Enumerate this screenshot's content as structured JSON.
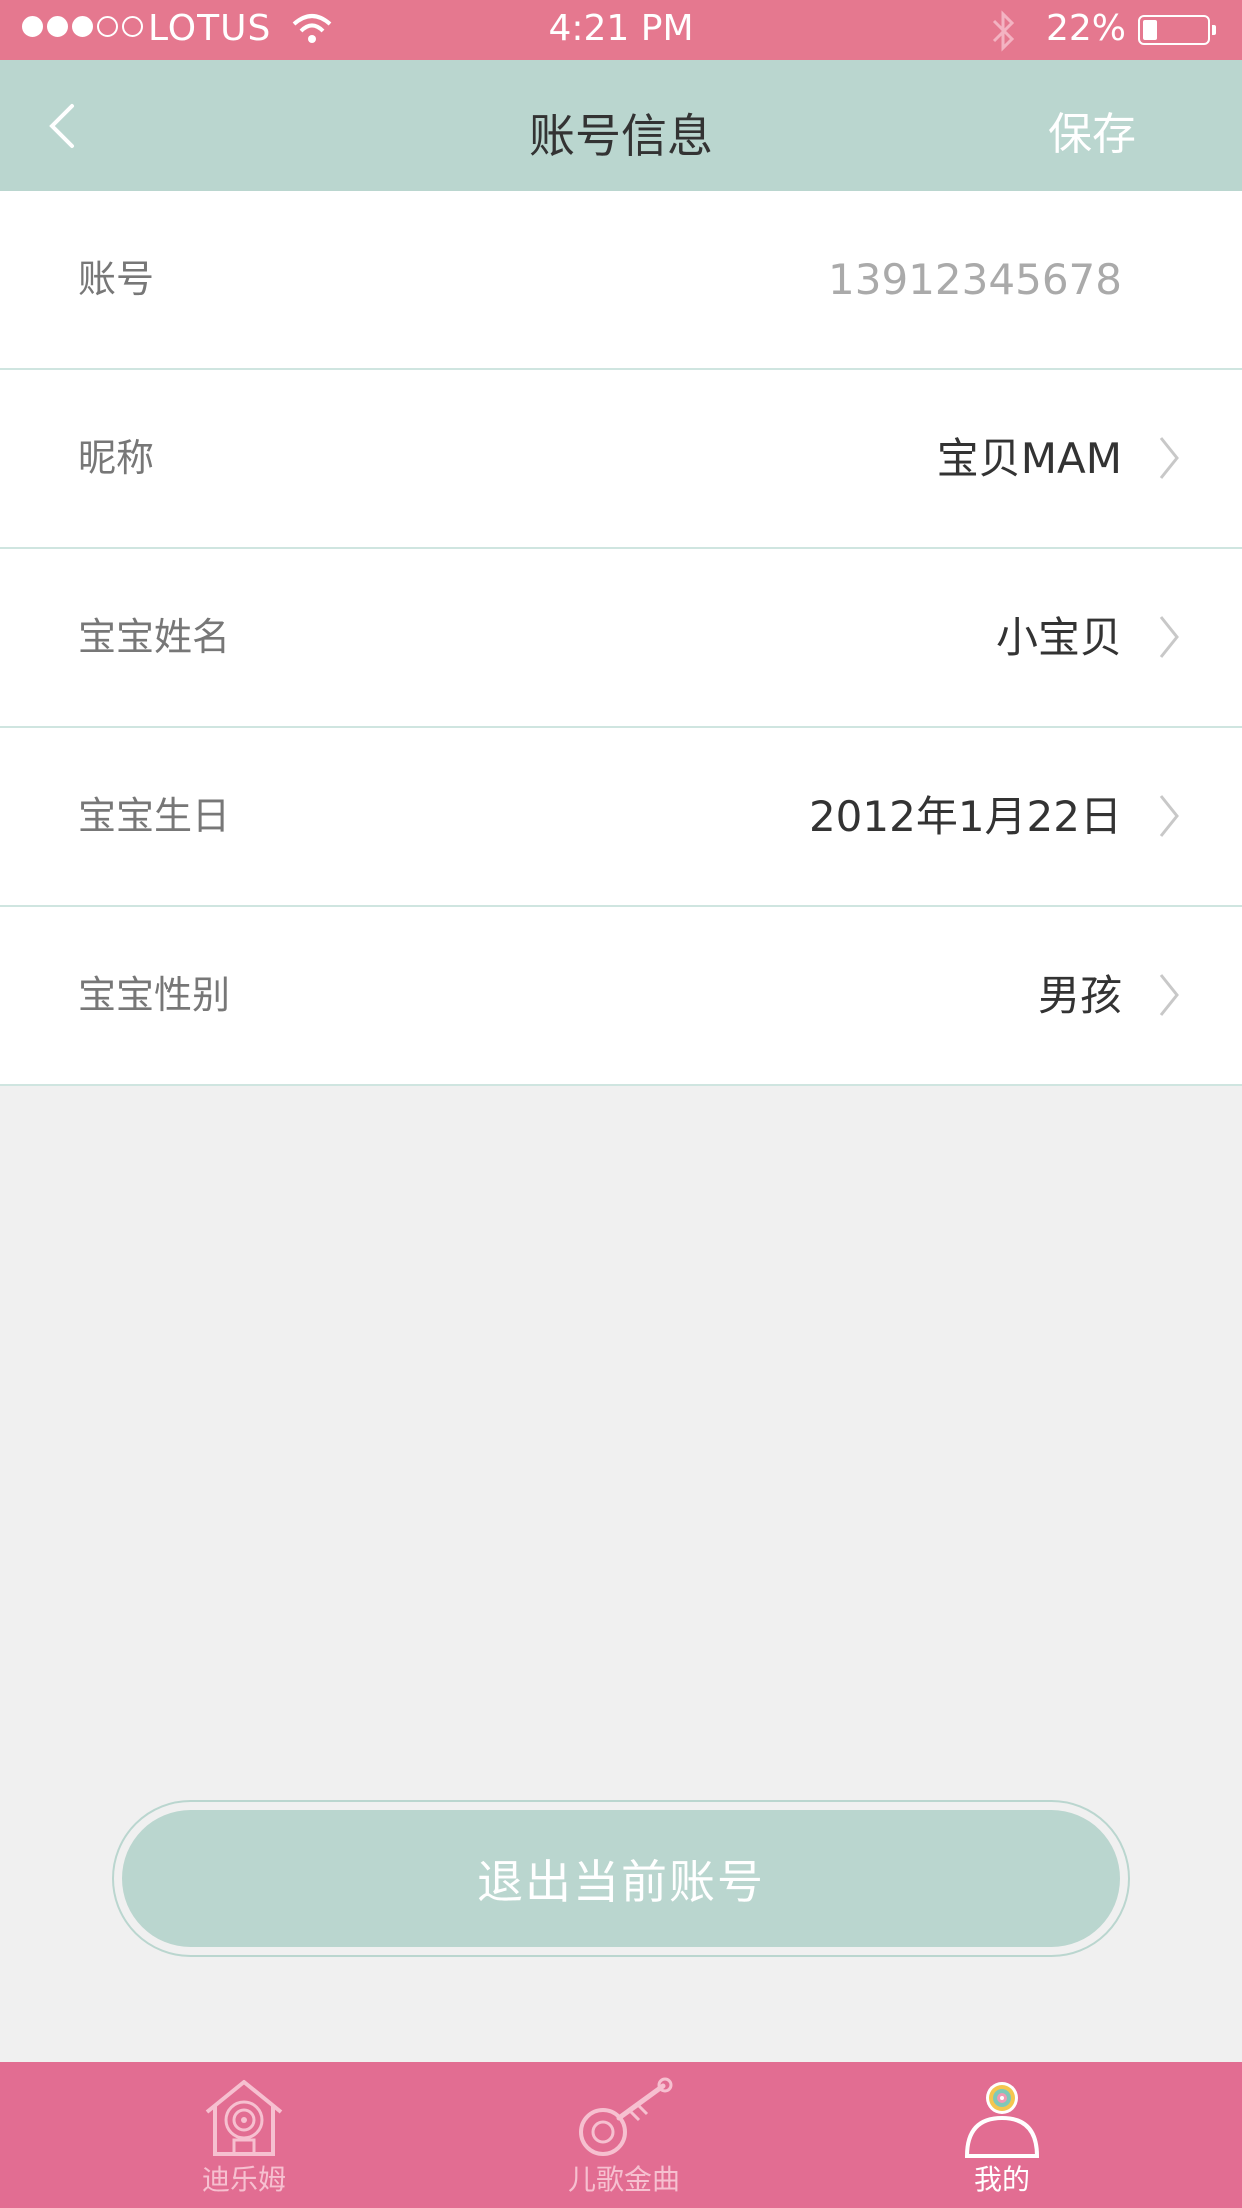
{
  "status_bar": {
    "carrier": "LOTUS",
    "time": "4:21 PM",
    "battery_percent": "22%",
    "battery_level": 0.22,
    "signal_bars": 3
  },
  "nav": {
    "title": "账号信息",
    "save_label": "保存"
  },
  "rows": [
    {
      "label": "账号",
      "value": "13912345678"
    },
    {
      "label": "昵称",
      "value": "宝贝MAM"
    },
    {
      "label": "宝宝姓名",
      "value": "小宝贝"
    },
    {
      "label": "宝宝生日",
      "value": "2012年1月22日"
    },
    {
      "label": "宝宝性别",
      "value": "男孩"
    }
  ],
  "logout_label": "退出当前账号",
  "tabs": [
    {
      "label": "迪乐姆",
      "icon": "home-swirl-icon",
      "active": false
    },
    {
      "label": "儿歌金曲",
      "icon": "guitar-icon",
      "active": false
    },
    {
      "label": "我的",
      "icon": "profile-icon",
      "active": true
    }
  ],
  "colors": {
    "status_bar": "#e5788f",
    "nav_bar": "#bad6cf",
    "tab_bar": "#e26d92",
    "background": "#f0f0f0"
  }
}
